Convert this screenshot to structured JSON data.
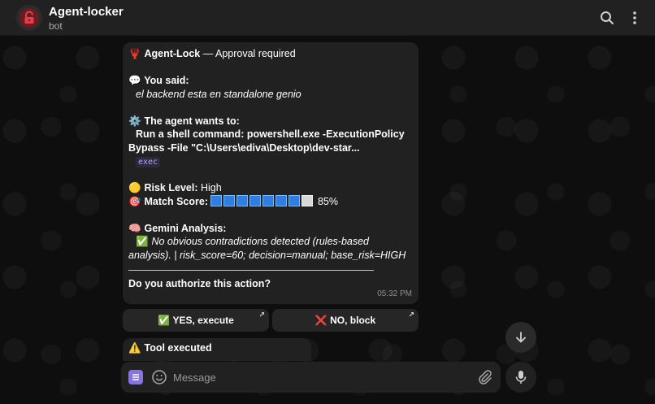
{
  "header": {
    "title": "Agent-locker",
    "subtitle": "bot",
    "icons": [
      "search-icon",
      "more-vertical-icon"
    ]
  },
  "message": {
    "heading_icon": "🦞",
    "heading_bold": "Agent-Lock",
    "heading_rest": " — Approval required",
    "you_said_icon": "💬",
    "you_said_label": "You said:",
    "you_said_text": "el backend esta en standalone genio",
    "wants_icon": "⚙️",
    "wants_label": "The agent wants to:",
    "command_line1": "Run a shell command: powershell.exe -ExecutionPolicy",
    "command_line2": "Bypass -File \"C:\\Users\\ediva\\Desktop\\dev-star...",
    "tool_tag": "exec",
    "risk_icon": "🟡",
    "risk_label": "Risk Level:",
    "risk_value": " High",
    "match_icon": "🎯",
    "match_label": "Match Score:",
    "match_fraction": 0.85,
    "match_value": "85%",
    "gemini_icon": "🧠",
    "gemini_label": "Gemini Analysis:",
    "check_icon": "✅",
    "analysis_line1": "No obvious contradictions detected (rules-based",
    "analysis_line2": "analysis).",
    "analysis_rest": " | risk_score=60; decision=manual; base_risk=HIGH",
    "question": "Do you authorize this action?",
    "time": "05:32 PM"
  },
  "buttons": {
    "yes_icon": "✅",
    "yes_label": "YES, execute",
    "no_icon": "❌",
    "no_label": "NO, block"
  },
  "next_message": {
    "icon": "⚠️",
    "text": "Tool executed"
  },
  "composer": {
    "placeholder": "Message"
  },
  "colors": {
    "header_bg": "#212121",
    "bubble_bg": "#212121",
    "accent": "#8774e1",
    "lock_red": "#d93640"
  }
}
